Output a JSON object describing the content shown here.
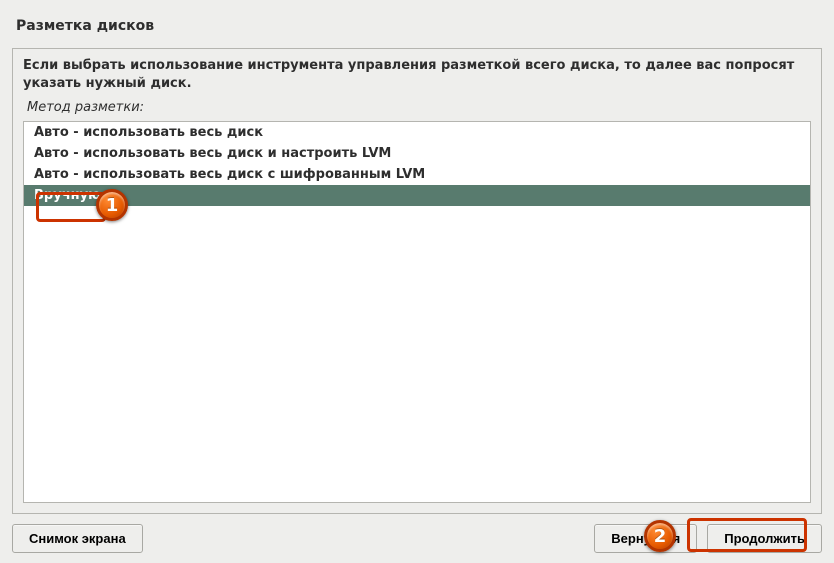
{
  "title": "Разметка дисков",
  "instruction": "Если выбрать использование инструмента управления разметкой всего диска, то далее вас попросят указать нужный диск.",
  "section_label": "Метод разметки:",
  "methods": [
    {
      "label": "Авто - использовать весь диск",
      "selected": false
    },
    {
      "label": "Авто - использовать весь диск и настроить LVM",
      "selected": false
    },
    {
      "label": "Авто - использовать весь диск с шифрованным LVM",
      "selected": false
    },
    {
      "label": "Вручную",
      "selected": true
    }
  ],
  "buttons": {
    "screenshot": "Снимок экрана",
    "back": "Вернуться",
    "continue": "Продолжить"
  },
  "callouts": {
    "one": "1",
    "two": "2"
  }
}
